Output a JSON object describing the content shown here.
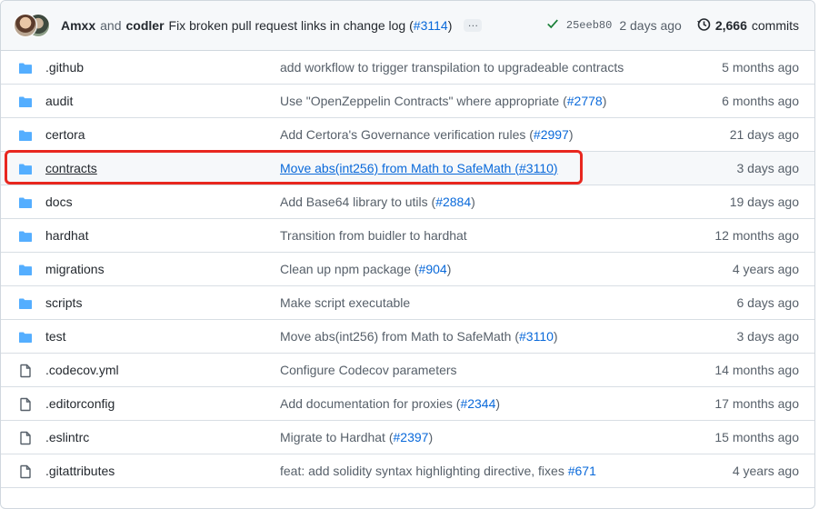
{
  "commit": {
    "author1": "Amxx",
    "and": "and",
    "author2": "codler",
    "message_prefix": "Fix broken pull request links in change log (",
    "pr": "#3114",
    "message_suffix": ")",
    "ellipsis": "…",
    "sha": "25eeb80",
    "time": "2 days ago",
    "commits_count": "2,666",
    "commits_label": "commits"
  },
  "files": [
    {
      "type": "folder",
      "name": ".github",
      "msg": "add workflow to trigger transpilation to upgradeable contracts",
      "pr": "",
      "suffix": "",
      "time": "5 months ago"
    },
    {
      "type": "folder",
      "name": "audit",
      "msg": "Use \"OpenZeppelin Contracts\" where appropriate (",
      "pr": "#2778",
      "suffix": ")",
      "time": "6 months ago"
    },
    {
      "type": "folder",
      "name": "certora",
      "msg": "Add Certora's Governance verification rules (",
      "pr": "#2997",
      "suffix": ")",
      "time": "21 days ago"
    },
    {
      "type": "folder",
      "name": "contracts",
      "msg": "Move abs(int256) from Math to SafeMath (",
      "pr": "#3110",
      "suffix": ")",
      "time": "3 days ago"
    },
    {
      "type": "folder",
      "name": "docs",
      "msg": "Add Base64 library to utils (",
      "pr": "#2884",
      "suffix": ")",
      "time": "19 days ago"
    },
    {
      "type": "folder",
      "name": "hardhat",
      "msg": "Transition from buidler to hardhat",
      "pr": "",
      "suffix": "",
      "time": "12 months ago"
    },
    {
      "type": "folder",
      "name": "migrations",
      "msg": "Clean up npm package (",
      "pr": "#904",
      "suffix": ")",
      "time": "4 years ago"
    },
    {
      "type": "folder",
      "name": "scripts",
      "msg": "Make script executable",
      "pr": "",
      "suffix": "",
      "time": "6 days ago"
    },
    {
      "type": "folder",
      "name": "test",
      "msg": "Move abs(int256) from Math to SafeMath (",
      "pr": "#3110",
      "suffix": ")",
      "time": "3 days ago"
    },
    {
      "type": "file",
      "name": ".codecov.yml",
      "msg": "Configure Codecov parameters",
      "pr": "",
      "suffix": "",
      "time": "14 months ago"
    },
    {
      "type": "file",
      "name": ".editorconfig",
      "msg": "Add documentation for proxies (",
      "pr": "#2344",
      "suffix": ")",
      "time": "17 months ago"
    },
    {
      "type": "file",
      "name": ".eslintrc",
      "msg": "Migrate to Hardhat (",
      "pr": "#2397",
      "suffix": ")",
      "time": "15 months ago"
    },
    {
      "type": "file",
      "name": ".gitattributes",
      "msg": "feat: add solidity syntax highlighting directive, fixes ",
      "pr": "#671",
      "suffix": "",
      "time": "4 years ago"
    }
  ],
  "colors": {
    "folder": "#54aeff",
    "file": "#57606a",
    "link": "#0969da",
    "highlight": "#e8271f"
  }
}
